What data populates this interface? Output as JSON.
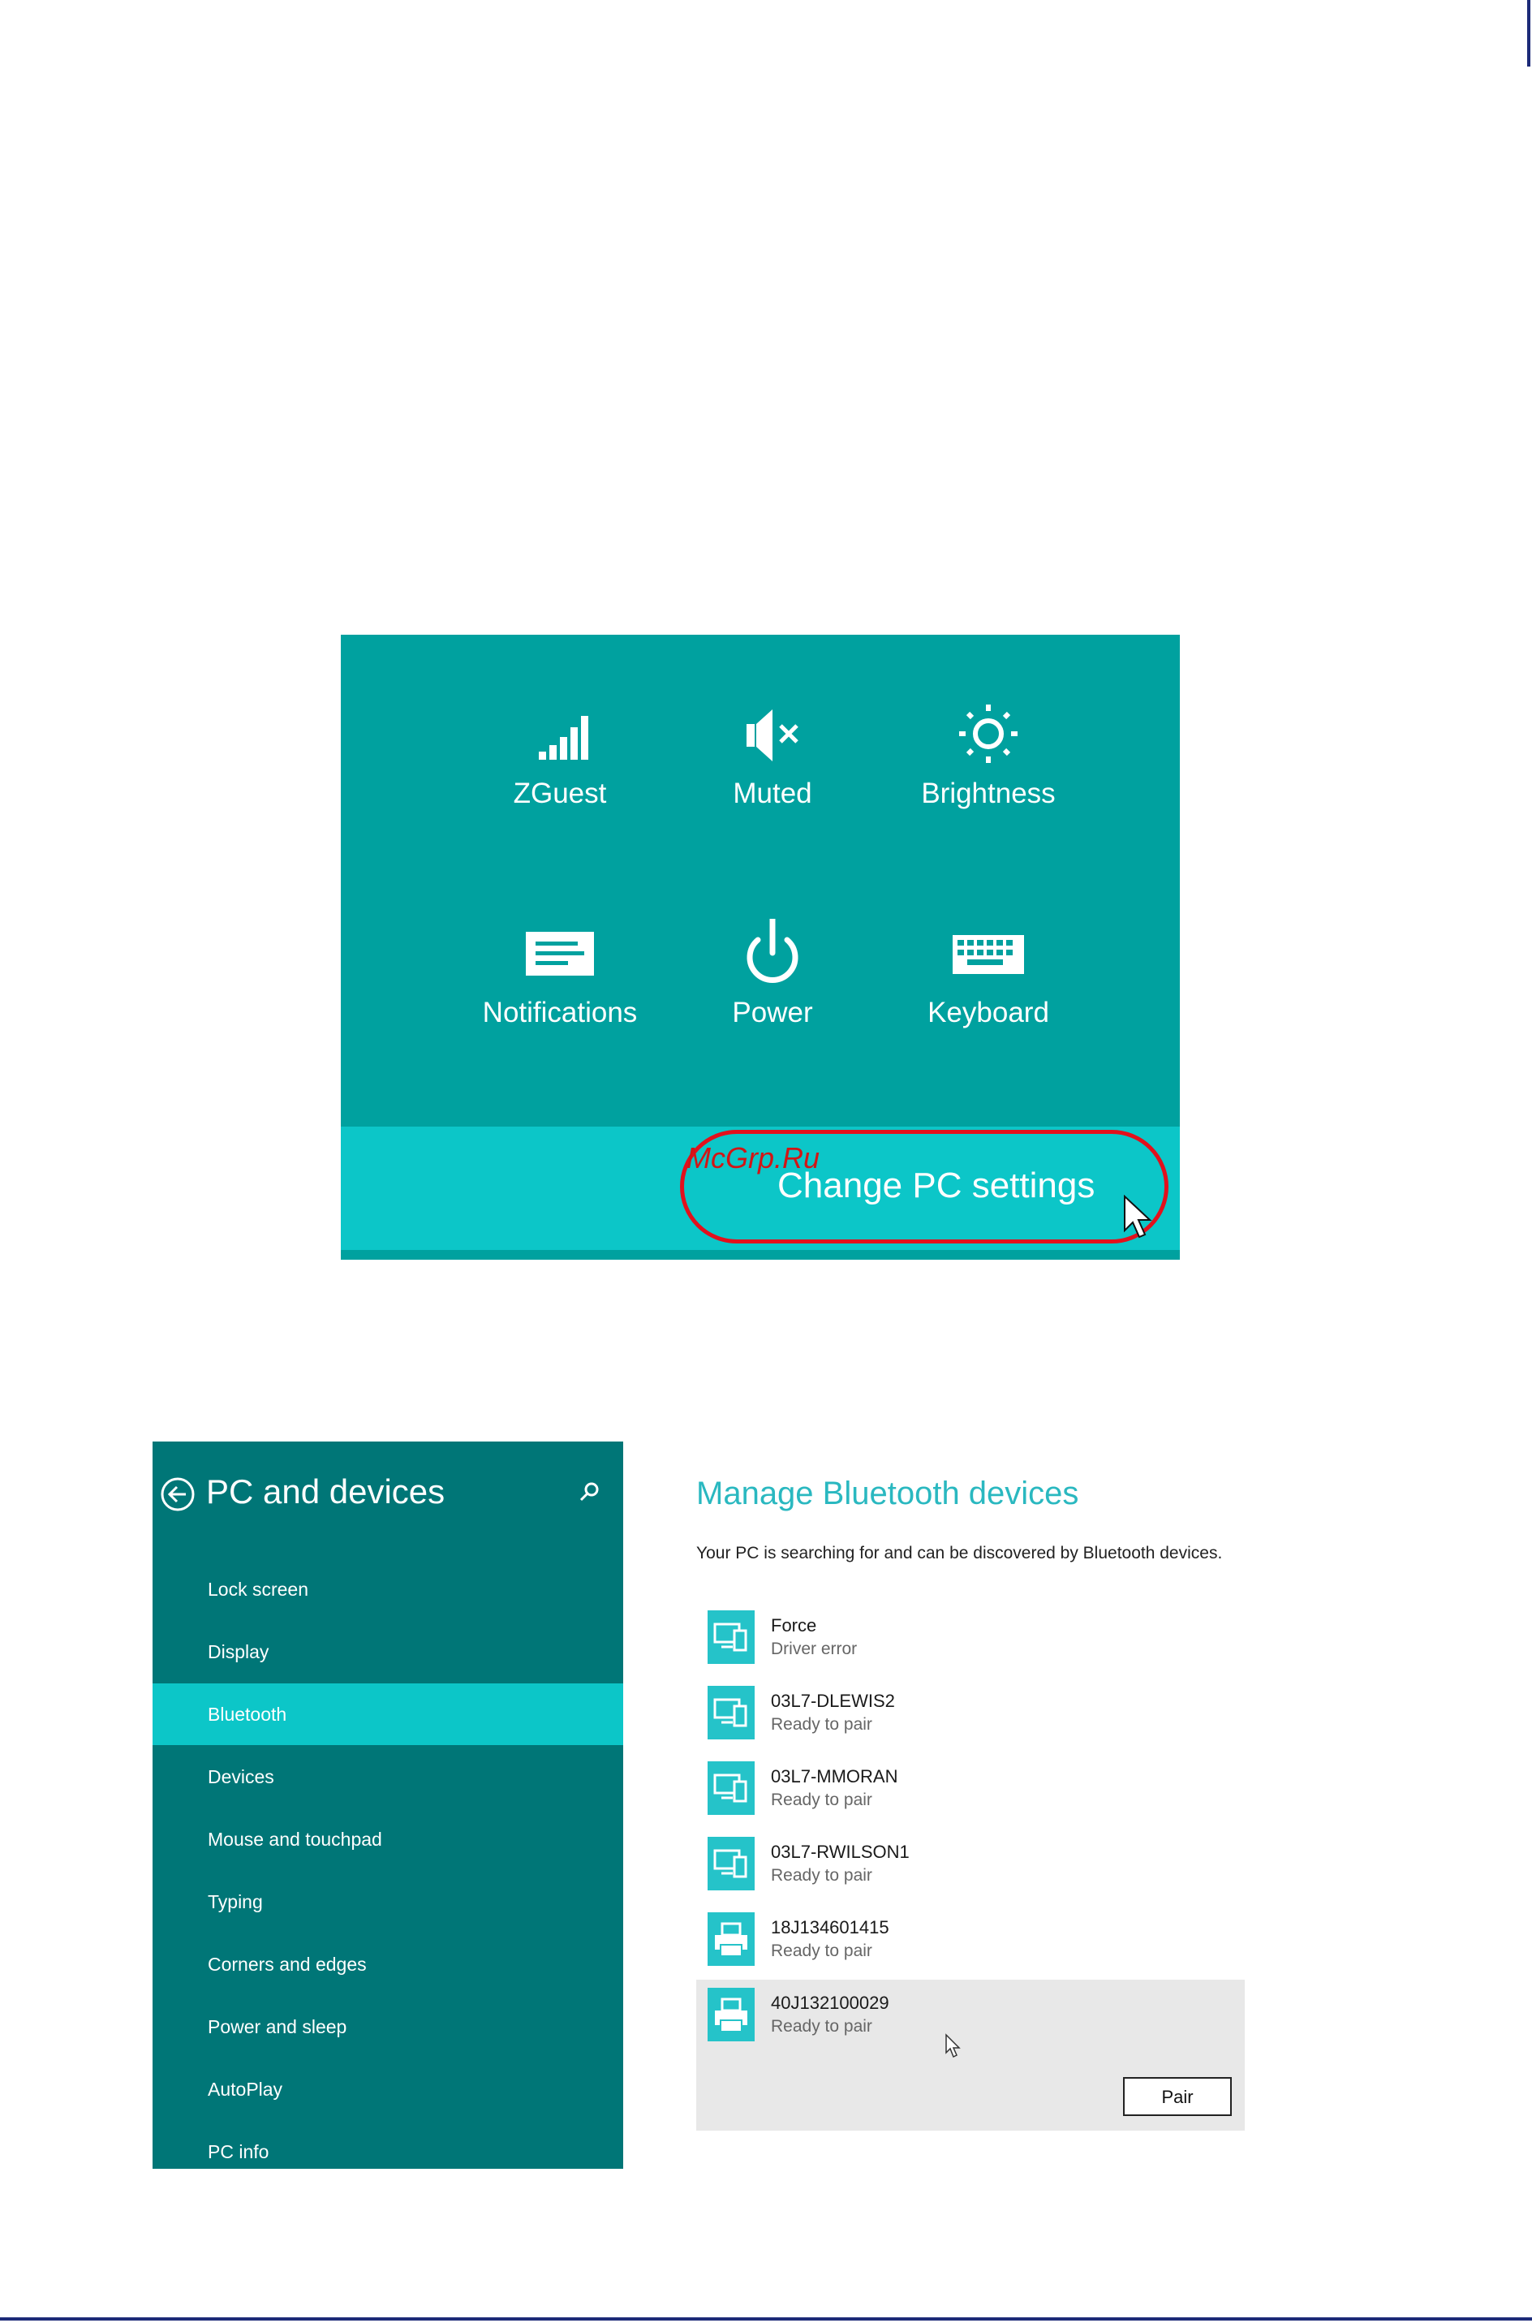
{
  "settings_charm": {
    "tiles": [
      {
        "label": "ZGuest",
        "icon": "signal-bars-icon"
      },
      {
        "label": "Muted",
        "icon": "speaker-muted-icon"
      },
      {
        "label": "Brightness",
        "icon": "sun-icon"
      },
      {
        "label": "Notifications",
        "icon": "message-icon"
      },
      {
        "label": "Power",
        "icon": "power-icon"
      },
      {
        "label": "Keyboard",
        "icon": "keyboard-icon"
      }
    ],
    "change_pc_settings": "Change PC settings",
    "watermark": "McGrp.Ru",
    "highlight_color": "#e3101c",
    "panel_color": "#00a19f",
    "bar_color": "#0cc6c8"
  },
  "sidebar": {
    "title": "PC and devices",
    "items": [
      {
        "label": "Lock screen"
      },
      {
        "label": "Display"
      },
      {
        "label": "Bluetooth",
        "selected": true
      },
      {
        "label": "Devices"
      },
      {
        "label": "Mouse and touchpad"
      },
      {
        "label": "Typing"
      },
      {
        "label": "Corners and edges"
      },
      {
        "label": "Power and sleep"
      },
      {
        "label": "AutoPlay"
      },
      {
        "label": "PC info"
      }
    ],
    "bg_color": "#007677",
    "selected_color": "#0cc6c8"
  },
  "bluetooth": {
    "title": "Manage Bluetooth devices",
    "description": "Your PC is searching for and can be discovered by Bluetooth devices.",
    "devices": [
      {
        "name": "Force",
        "status": "Driver error",
        "icon": "computer-phone-icon"
      },
      {
        "name": "03L7-DLEWIS2",
        "status": "Ready to pair",
        "icon": "computer-phone-icon"
      },
      {
        "name": "03L7-MMORAN",
        "status": "Ready to pair",
        "icon": "computer-phone-icon"
      },
      {
        "name": "03L7-RWILSON1",
        "status": "Ready to pair",
        "icon": "computer-phone-icon"
      },
      {
        "name": "18J134601415",
        "status": "Ready to pair",
        "icon": "printer-icon"
      },
      {
        "name": "40J132100029",
        "status": "Ready to pair",
        "icon": "printer-icon",
        "selected": true
      }
    ],
    "pair_label": "Pair",
    "accent_color": "#2ab8c0"
  }
}
